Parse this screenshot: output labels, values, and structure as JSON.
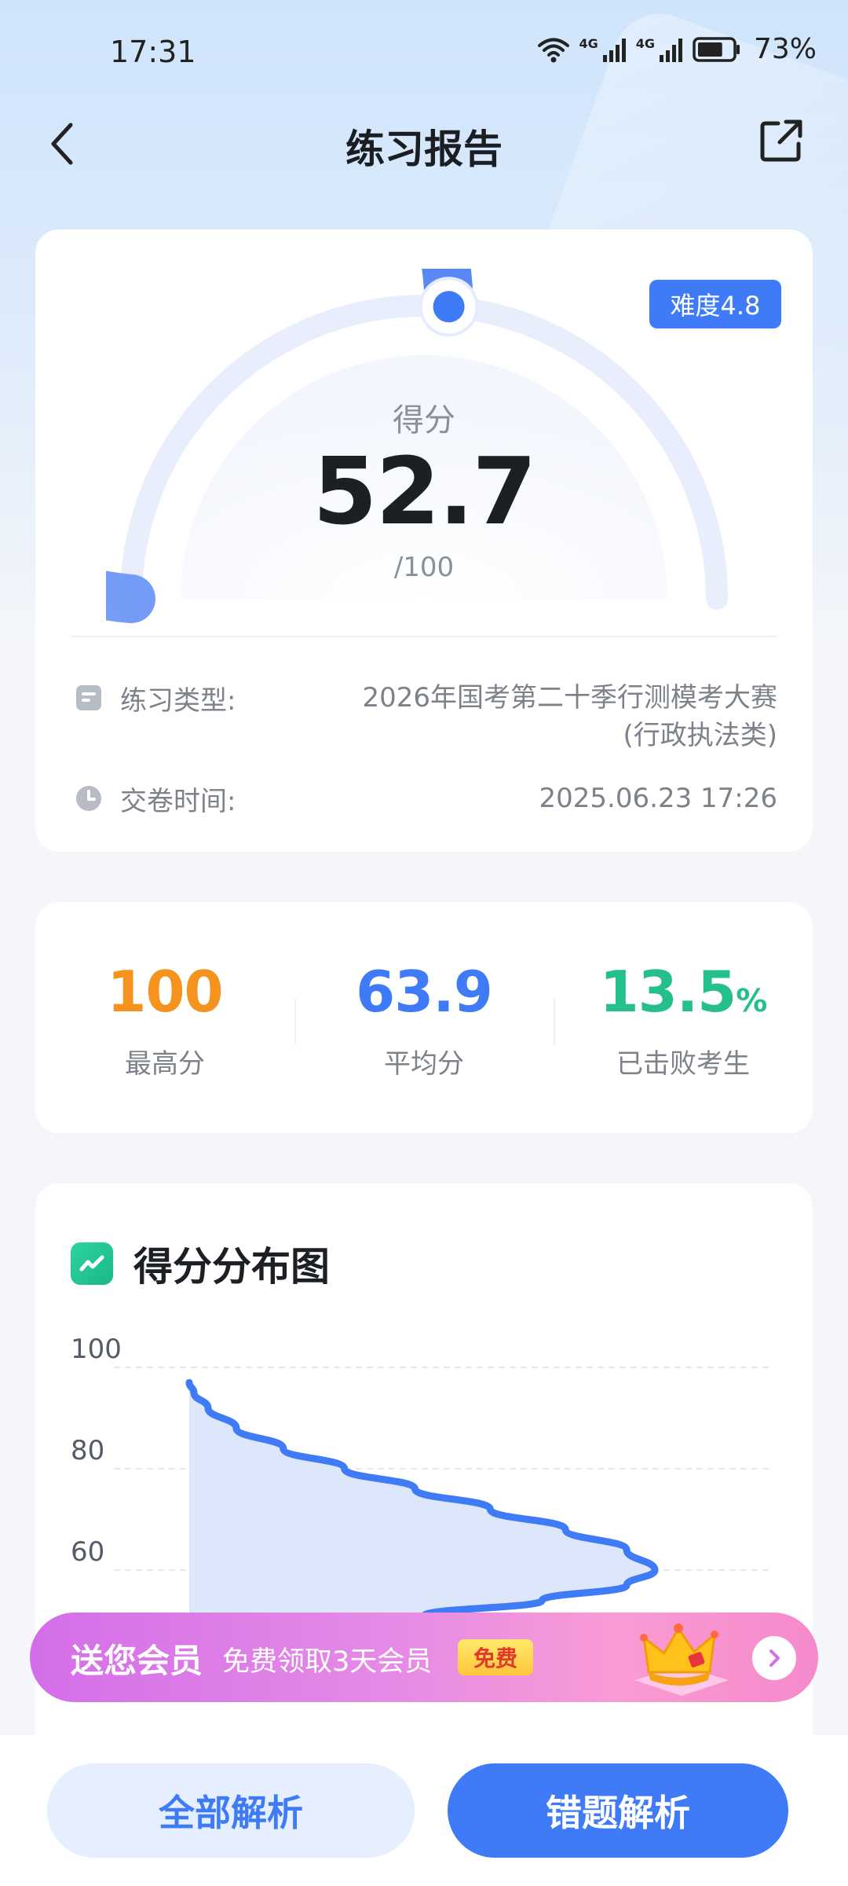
{
  "status_bar": {
    "time": "17:31",
    "signal1_label": "4G",
    "signal2_label": "4G",
    "battery": "73%",
    "battery_level": 0.73
  },
  "nav": {
    "title": "练习报告",
    "back_icon": "chevron-left-icon",
    "share_icon": "share-icon"
  },
  "score_card": {
    "difficulty": "难度4.8",
    "score_label": "得分",
    "score": "52.7",
    "score_max": "/100",
    "score_fraction": 0.527,
    "info": {
      "type_label": "练习类型:",
      "type_value_line1": "2026年国考第二十季行测模考大赛",
      "type_value_line2": "(行政执法类)",
      "time_label": "交卷时间:",
      "time_value": "2025.06.23 17:26"
    }
  },
  "stats": [
    {
      "value": "100",
      "unit": "",
      "label": "最高分",
      "color": "#f5931e"
    },
    {
      "value": "63.9",
      "unit": "",
      "label": "平均分",
      "color": "#3f7af7"
    },
    {
      "value": "13.5",
      "unit": "%",
      "label": "已击败考生",
      "color": "#25c08a"
    }
  ],
  "distribution": {
    "title": "得分分布图",
    "icon": "trend-chart-icon"
  },
  "chart_data": {
    "type": "area",
    "title": "得分分布图",
    "y_ticks": [
      "100",
      "80",
      "60"
    ],
    "ylim": [
      40,
      100
    ],
    "grid": true,
    "curve": {
      "y": [
        97,
        95,
        92,
        88,
        84,
        80,
        76,
        72,
        68,
        64,
        60,
        57,
        54,
        51,
        48,
        45,
        42,
        39
      ],
      "density": [
        0.0,
        0.01,
        0.04,
        0.1,
        0.2,
        0.33,
        0.48,
        0.64,
        0.8,
        0.93,
        0.99,
        0.93,
        0.75,
        0.5,
        0.28,
        0.12,
        0.04,
        0.0
      ]
    }
  },
  "promo": {
    "main": "送您会员",
    "sub": "免费领取3天会员",
    "badge": "免费"
  },
  "actions": {
    "all_label": "全部解析",
    "wrong_label": "错题解析"
  }
}
